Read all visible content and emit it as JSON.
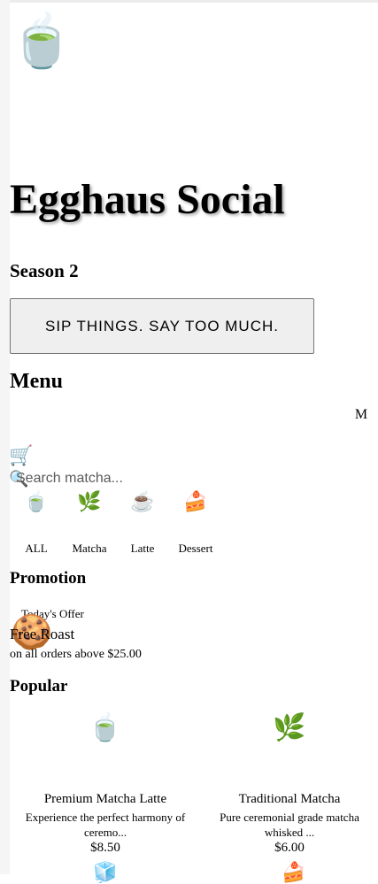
{
  "header": {
    "logo_icon": "teacup-icon",
    "logo_glyph": "🍵",
    "title": "Egghaus Social",
    "season": "Season 2",
    "tagline": "SIP THINGS. SAY TOO MUCH."
  },
  "menu": {
    "heading": "Menu",
    "menu_button": "M",
    "cart_glyph": "🛒",
    "search_glyph": "🔍",
    "search_placeholder": "Search matcha..."
  },
  "categories": [
    {
      "icon": "🍵",
      "label": "ALL"
    },
    {
      "icon": "🌿",
      "label": "Matcha"
    },
    {
      "icon": "☕",
      "label": "Latte"
    },
    {
      "icon": "🍰",
      "label": "Dessert"
    }
  ],
  "promotion": {
    "heading": "Promotion",
    "label": "Today's Offer",
    "icon": "🍪",
    "title": "Free Roast",
    "subtitle": "on all orders above $25.00"
  },
  "popular": {
    "heading": "Popular",
    "items": [
      {
        "icon": "🍵",
        "name": "Premium Matcha Latte",
        "desc": "Experience the perfect harmony of ceremo...",
        "price": "$8.50"
      },
      {
        "icon": "🌿",
        "name": "Traditional Matcha",
        "desc": "Pure ceremonial grade matcha whisked ...",
        "price": "$6.00"
      }
    ],
    "next_icons": [
      "🧊",
      "🍰"
    ]
  }
}
